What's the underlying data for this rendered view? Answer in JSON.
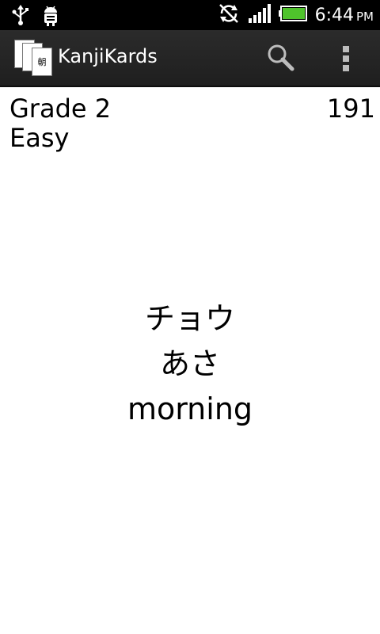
{
  "status_bar": {
    "time": "6:44",
    "ampm": "PM",
    "left_icons": [
      "usb-icon",
      "android-debug-icon"
    ],
    "right_icons": [
      "sync-icon",
      "signal-icon",
      "battery-icon"
    ],
    "battery_color": "#4fc32c"
  },
  "action_bar": {
    "app_icon_glyph": "朝",
    "title": "KanjiKards",
    "search_icon": "search-icon",
    "overflow_icon": "overflow-menu-icon"
  },
  "content": {
    "grade": "Grade 2",
    "difficulty": "Easy",
    "count": "191",
    "card": {
      "onyomi": "チョウ",
      "kunyomi": "あさ",
      "meaning": "morning"
    }
  },
  "colors": {
    "status_bar_bg": "#000000",
    "action_bar_bg": "#262626",
    "content_bg": "#ffffff",
    "text": "#000000"
  }
}
